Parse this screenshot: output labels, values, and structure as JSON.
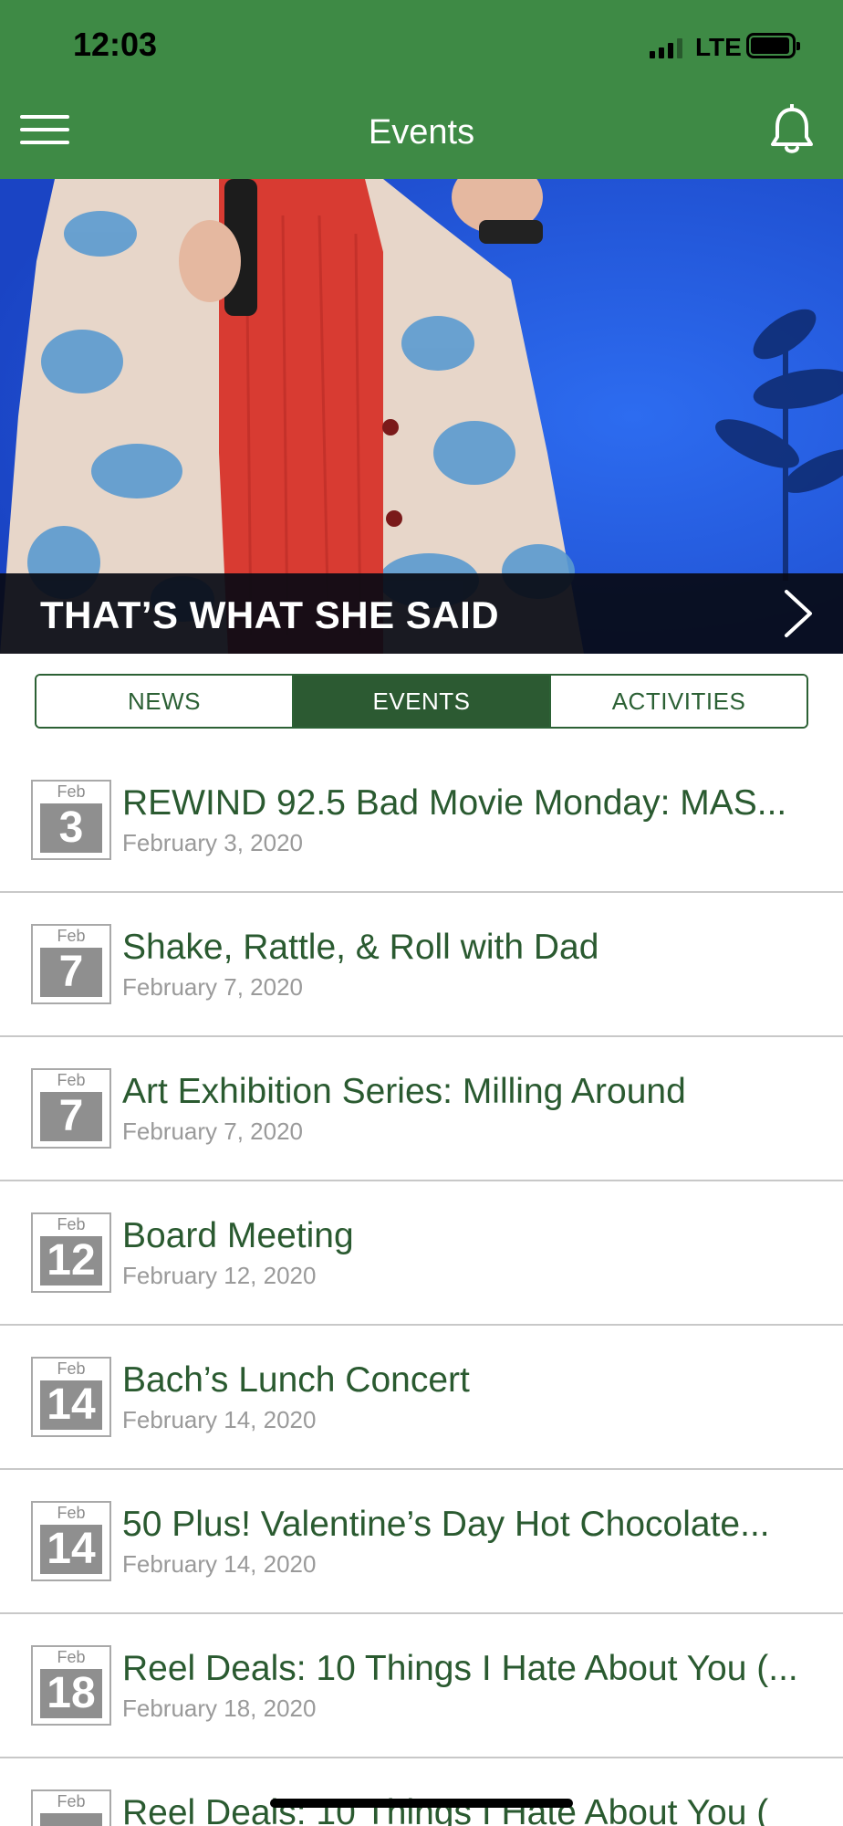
{
  "status_bar": {
    "time": "12:03",
    "network": "LTE"
  },
  "header": {
    "title": "Events"
  },
  "hero": {
    "title": "THAT’S WHAT SHE SAID"
  },
  "tabs": [
    {
      "label": "NEWS",
      "active": false
    },
    {
      "label": "EVENTS",
      "active": true
    },
    {
      "label": "ACTIVITIES",
      "active": false
    }
  ],
  "events": [
    {
      "month": "Feb",
      "day": "3",
      "title": "REWIND 92.5 Bad Movie Monday: MAS...",
      "date": "February 3, 2020"
    },
    {
      "month": "Feb",
      "day": "7",
      "title": "Shake, Rattle, & Roll with Dad",
      "date": "February 7, 2020"
    },
    {
      "month": "Feb",
      "day": "7",
      "title": "Art Exhibition Series: Milling Around",
      "date": "February 7, 2020"
    },
    {
      "month": "Feb",
      "day": "12",
      "title": "Board Meeting",
      "date": "February 12, 2020"
    },
    {
      "month": "Feb",
      "day": "14",
      "title": "Bach’s Lunch Concert",
      "date": "February 14, 2020"
    },
    {
      "month": "Feb",
      "day": "14",
      "title": "50 Plus! Valentine’s Day Hot Chocolate...",
      "date": "February 14, 2020"
    },
    {
      "month": "Feb",
      "day": "18",
      "title": "Reel Deals: 10 Things I Hate About You (...",
      "date": "February 18, 2020"
    },
    {
      "month": "Feb",
      "day": "",
      "title": "Reel Deals: 10 Things I Hate About You (",
      "date": ""
    }
  ],
  "colors": {
    "header_green": "#3e8a45",
    "dark_green": "#2c5a32",
    "text_green": "#2a5a30",
    "hero_blue": "#2357d8"
  }
}
